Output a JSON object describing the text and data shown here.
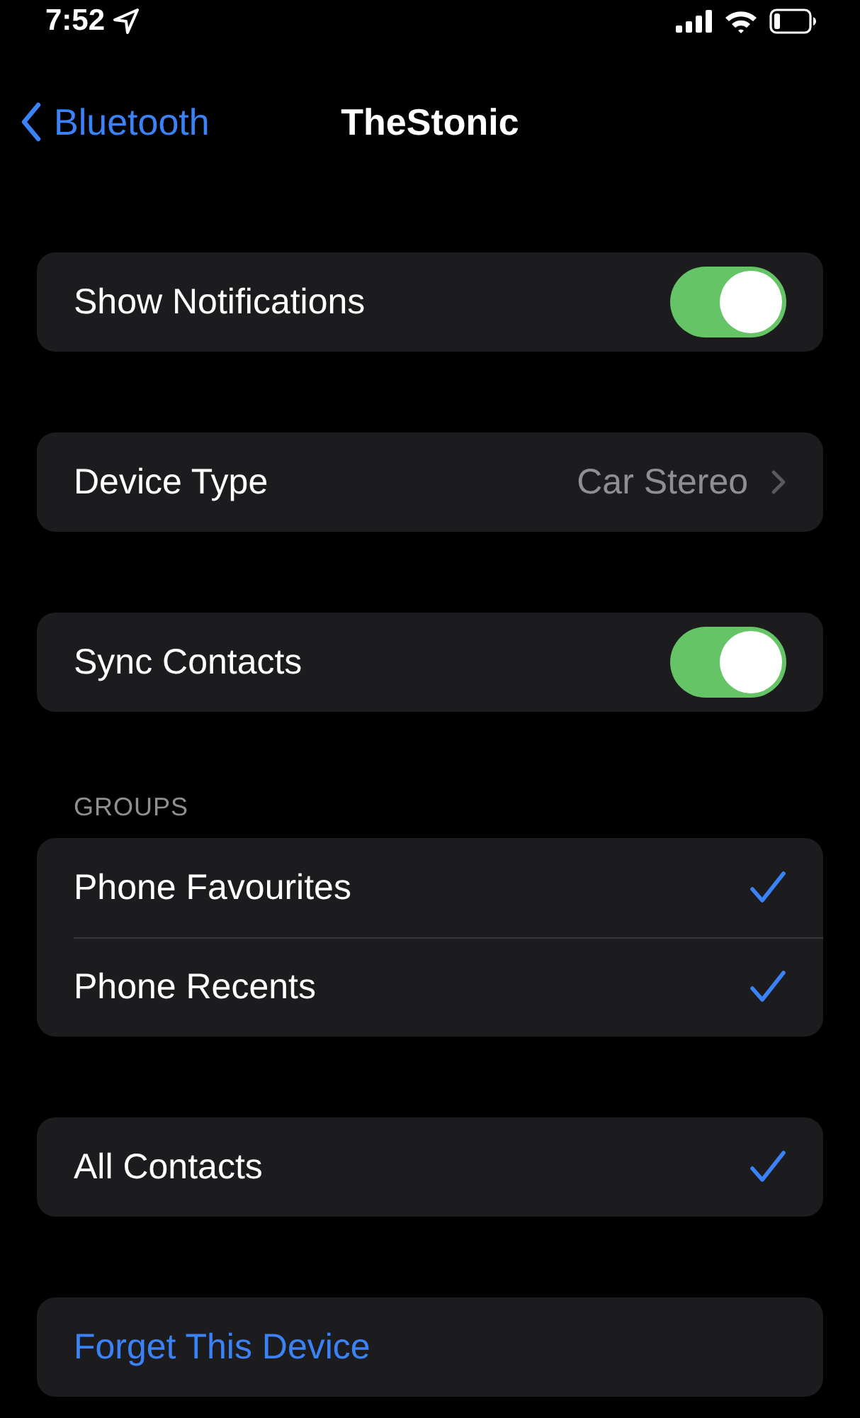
{
  "status_bar": {
    "time": "7:52"
  },
  "nav": {
    "back": "Bluetooth",
    "title": "TheStonic"
  },
  "sections": [
    {
      "rows": [
        {
          "kind": "toggle",
          "label": "Show Notifications",
          "on": true
        }
      ]
    },
    {
      "rows": [
        {
          "kind": "disclosure",
          "label": "Device Type",
          "value": "Car Stereo"
        }
      ]
    },
    {
      "rows": [
        {
          "kind": "toggle",
          "label": "Sync Contacts",
          "on": true
        }
      ]
    },
    {
      "header": "GROUPS",
      "rows": [
        {
          "kind": "check",
          "label": "Phone Favourites",
          "checked": true
        },
        {
          "kind": "check",
          "label": "Phone Recents",
          "checked": true
        }
      ]
    },
    {
      "rows": [
        {
          "kind": "check",
          "label": "All Contacts",
          "checked": true
        }
      ]
    },
    {
      "rows": [
        {
          "kind": "action",
          "label": "Forget This Device"
        }
      ]
    }
  ]
}
